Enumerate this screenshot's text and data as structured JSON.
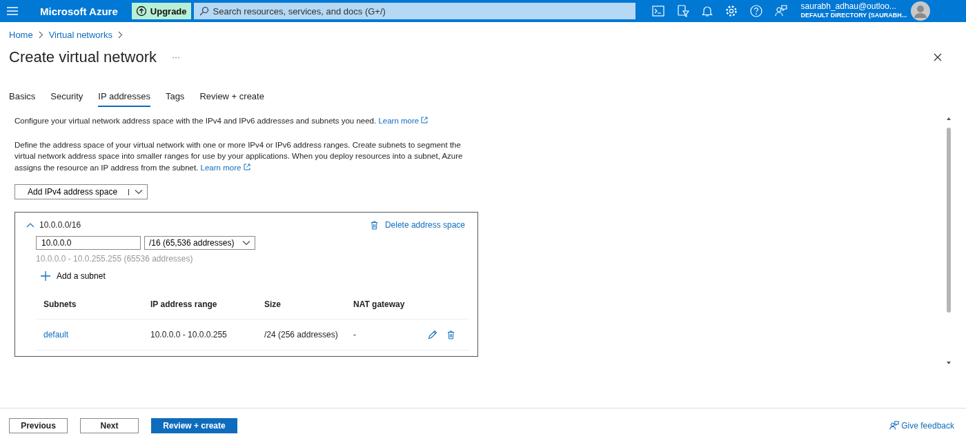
{
  "topbar": {
    "brand": "Microsoft Azure",
    "upgrade": "Upgrade",
    "search": {
      "placeholder": "Search resources, services, and docs (G+/)"
    },
    "account": {
      "user": "saurabh_adhau@outloo...",
      "directory": "DEFAULT DIRECTORY (SAURABH..."
    }
  },
  "breadcrumb": [
    "Home",
    "Virtual networks"
  ],
  "title": "Create virtual network",
  "more": "···",
  "tabs": [
    {
      "label": "Basics",
      "selected": false
    },
    {
      "label": "Security",
      "selected": false
    },
    {
      "label": "IP addresses",
      "selected": true
    },
    {
      "label": "Tags",
      "selected": false
    },
    {
      "label": "Review + create",
      "selected": false
    }
  ],
  "intro": {
    "text": "Configure your virtual network address space with the IPv4 and IPv6 addresses and subnets you need.",
    "link": "Learn more"
  },
  "description": {
    "text": "Define the address space of your virtual network with one or more IPv4 or IPv6 address ranges. Create subnets to segment the virtual network address space into smaller ranges for use by your applications. When you deploy resources into a subnet, Azure assigns the resource an IP address from the subnet.",
    "link": "Learn more"
  },
  "add_space_button": "Add IPv4 address space",
  "address_space": {
    "title": "10.0.0.0/16",
    "expanded": true,
    "delete": "Delete address space",
    "address": "10.0.0.0",
    "prefix": "/16 (65,536 addresses)",
    "range": "10.0.0.0 - 10.0.255.255 (65536 addresses)",
    "add_subnet": "Add a subnet",
    "columns": [
      "Subnets",
      "IP address range",
      "Size",
      "NAT gateway"
    ],
    "rows": [
      {
        "name": "default",
        "range": "10.0.0.0 - 10.0.0.255",
        "size": "/24 (256 addresses)",
        "nat": "-"
      }
    ]
  },
  "footer": {
    "previous": "Previous",
    "next": "Next",
    "review": "Review + create",
    "feedback": "Give feedback"
  }
}
